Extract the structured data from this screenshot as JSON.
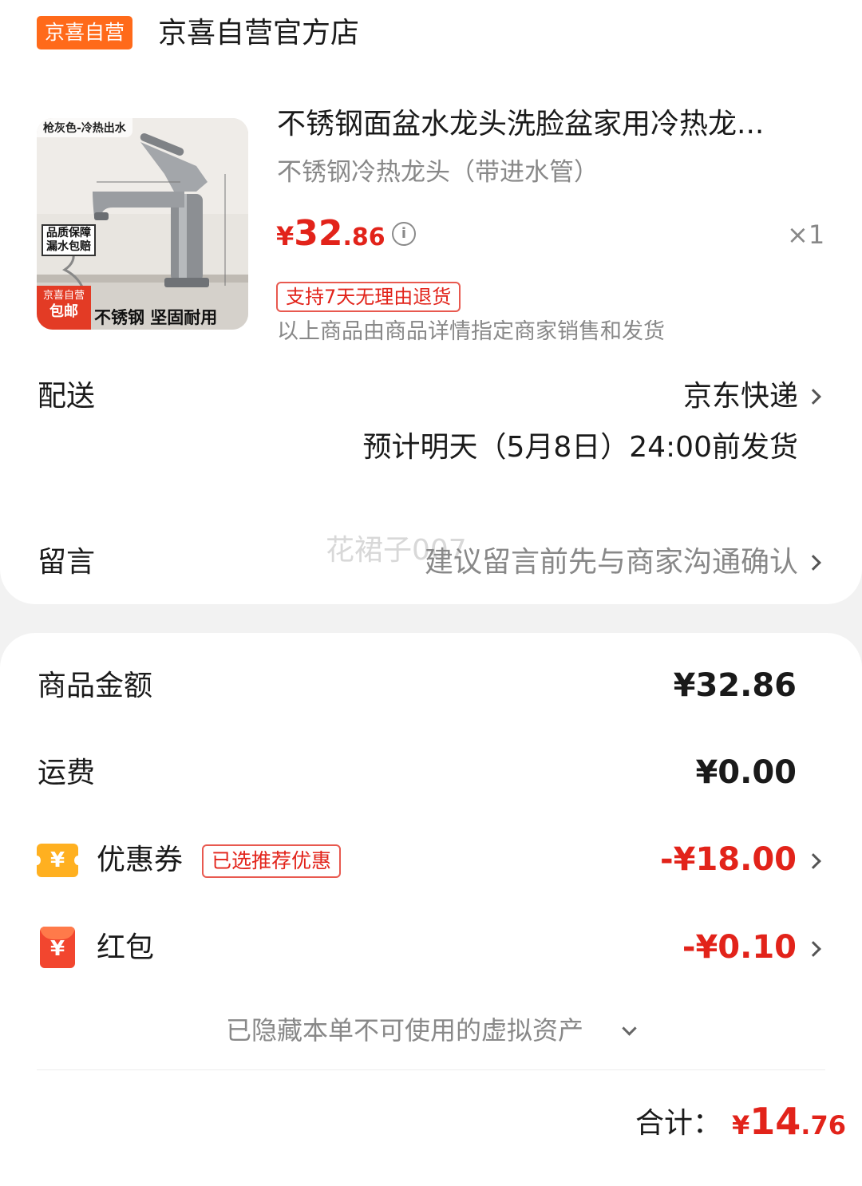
{
  "store": {
    "badge": "京喜自营",
    "name": "京喜自营官方店"
  },
  "product": {
    "image_tag_top": "枪灰色-冷热出水",
    "image_tag_quality": "品质保障 漏水包赔",
    "image_badge_line1": "京喜自营",
    "image_badge_line2": "包邮",
    "image_tag_bottom": "不锈钢 坚固耐用",
    "title": "不锈钢面盆水龙头洗脸盆家用冷热龙...",
    "spec": "不锈钢冷热龙头（带进水管）",
    "price_symbol": "¥",
    "price_int": "32",
    "price_dec": ".86",
    "quantity": "×1",
    "return_tag": "支持7天无理由退货",
    "seller_note": "以上商品由商品详情指定商家销售和发货"
  },
  "delivery": {
    "label": "配送",
    "carrier": "京东快递",
    "estimate": "预计明天（5月8日）24:00前发货"
  },
  "message": {
    "label": "留言",
    "placeholder": "建议留言前先与商家沟通确认",
    "watermark": "花裙子007"
  },
  "summary": {
    "goods_label": "商品金额",
    "goods_value": "¥32.86",
    "shipping_label": "运费",
    "shipping_value": "¥0.00",
    "coupon_label": "优惠券",
    "coupon_icon": "¥",
    "coupon_tag": "已选推荐优惠",
    "coupon_value": "-¥18.00",
    "redpack_label": "红包",
    "redpack_icon": "¥",
    "redpack_value": "-¥0.10",
    "hidden_assets": "已隐藏本单不可使用的虚拟资产",
    "total_label": "合计：",
    "total_symbol": "¥",
    "total_int": "14",
    "total_dec": ".76"
  },
  "colors": {
    "accent_red": "#e2231a",
    "badge_orange": "#ff6a1a",
    "coupon_yellow": "#ffb020",
    "muted_grey": "#888888"
  }
}
